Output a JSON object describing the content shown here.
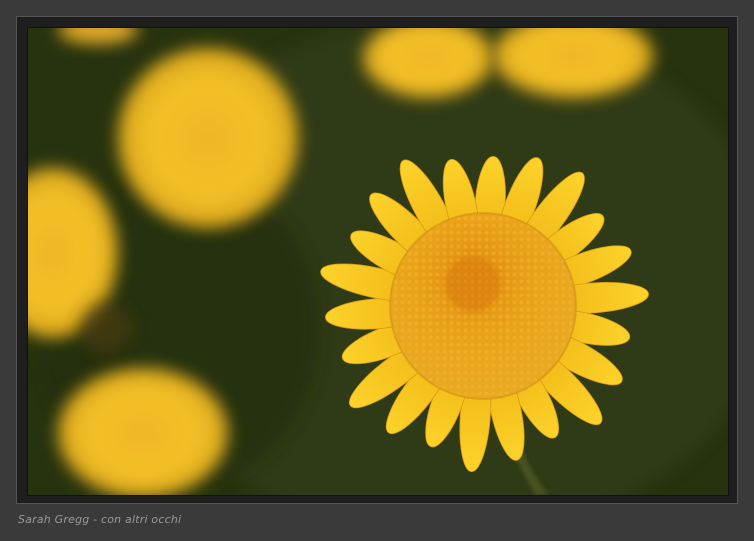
{
  "photo": {
    "subject": "yellow-daisy-flower",
    "colors": {
      "background_green": "#2d3815",
      "petal_yellow": "#f5c21a",
      "center_orange": "#e7a31a",
      "frame_gray": "#3a3a3a"
    }
  },
  "caption": {
    "text": "Sarah Gregg - con altri occhi"
  }
}
